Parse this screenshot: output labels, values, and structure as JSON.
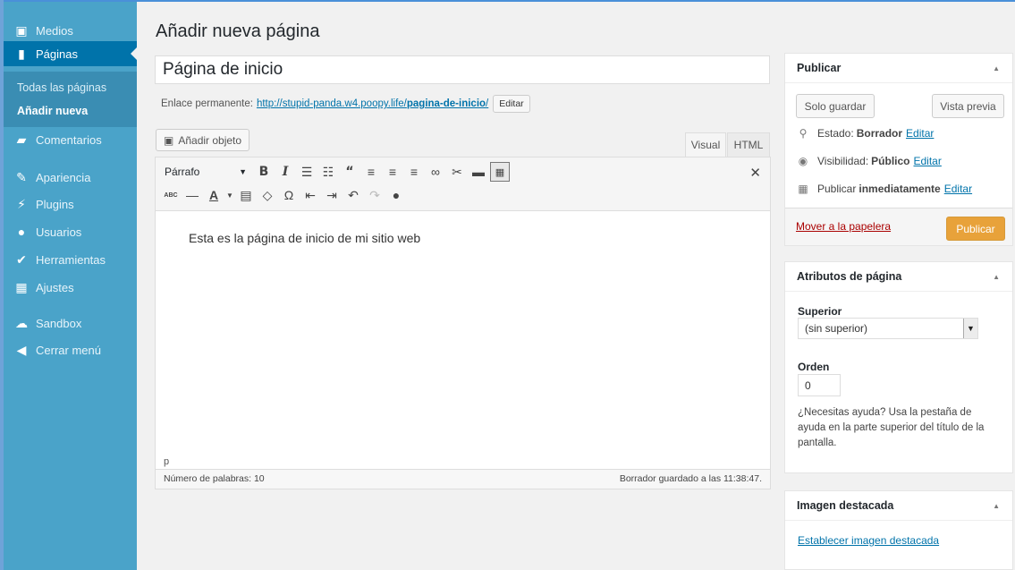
{
  "colors": {
    "sidebar": "#4aa3c9",
    "sidebar_active": "#0073aa",
    "publish": "#e8a23a",
    "link": "#0073aa",
    "trash": "#a00"
  },
  "sidebar": {
    "items": [
      {
        "label": "Medios",
        "icon": "media-icon"
      },
      {
        "label": "Páginas",
        "icon": "pages-icon"
      },
      {
        "label": "Comentarios",
        "icon": "comments-icon"
      },
      {
        "label": "Apariencia",
        "icon": "appearance-icon"
      },
      {
        "label": "Plugins",
        "icon": "plugins-icon"
      },
      {
        "label": "Usuarios",
        "icon": "users-icon"
      },
      {
        "label": "Herramientas",
        "icon": "tools-icon"
      },
      {
        "label": "Ajustes",
        "icon": "settings-icon"
      },
      {
        "label": "Sandbox",
        "icon": "cloud-icon"
      },
      {
        "label": "Cerrar menú",
        "icon": "collapse-icon"
      }
    ],
    "submenu": [
      "Todas las páginas",
      "Añadir nueva"
    ]
  },
  "page": {
    "title": "Añadir nueva página",
    "title_value": "Página de inicio",
    "permalink_label": "Enlace permanente:",
    "permalink_base": "http://stupid-panda.w4.poopy.life/",
    "permalink_slug": "pagina-de-inicio",
    "permalink_end": "/",
    "permalink_edit": "Editar"
  },
  "editor": {
    "add_media": "Añadir objeto",
    "tab_visual": "Visual",
    "tab_html": "HTML",
    "format": "Párrafo",
    "content": "Esta es la página de inicio de mi sitio web",
    "path": "p",
    "word_count": "Número de palabras: 10",
    "saved": "Borrador guardado a las 11:38:47."
  },
  "publish": {
    "title": "Publicar",
    "save_draft": "Solo guardar",
    "preview": "Vista previa",
    "status_label": "Estado:",
    "status_value": "Borrador",
    "visibility_label": "Visibilidad:",
    "visibility_value": "Público",
    "publish_label": "Publicar",
    "publish_value": "inmediatamente",
    "edit": "Editar",
    "trash": "Mover a la papelera",
    "publish_button": "Publicar"
  },
  "attributes": {
    "title": "Atributos de página",
    "parent_label": "Superior",
    "parent_value": "(sin superior)",
    "order_label": "Orden",
    "order_value": "0",
    "help": "¿Necesitas ayuda? Usa la pestaña de ayuda en la parte superior del título de la pantalla."
  },
  "featured": {
    "title": "Imagen destacada",
    "link": "Establecer imagen destacada"
  }
}
